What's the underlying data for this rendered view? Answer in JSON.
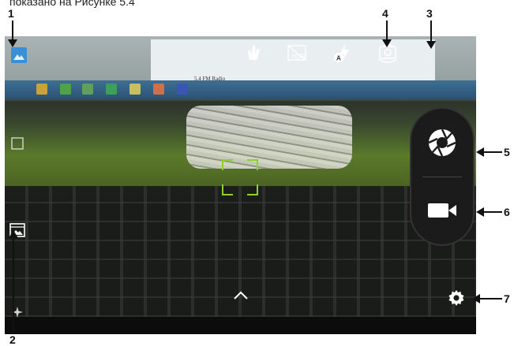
{
  "caption": "показано на Рисунке 5.4",
  "callouts": [
    "1",
    "2",
    "3",
    "4",
    "5",
    "6",
    "7"
  ],
  "document_title": "5.4 FM Radio",
  "icons": {
    "gallery_thumb": "gallery-thumbnail-icon",
    "panorama": "panorama-mode-icon",
    "camera_mode": "camera-mode-icon",
    "gesture": "gesture-icon",
    "hdr": "hdr-icon",
    "flash": "flash-auto-icon",
    "switch_camera": "switch-camera-icon",
    "shutter": "shutter-icon",
    "video": "video-record-icon",
    "settings": "gear-icon",
    "expand": "chevron-up-icon"
  },
  "hdr_label": "HDR",
  "flash_label": "A",
  "colors": {
    "focus": "#8fd02a",
    "panel": "#1b1b1b",
    "icon": "#ffffff"
  }
}
